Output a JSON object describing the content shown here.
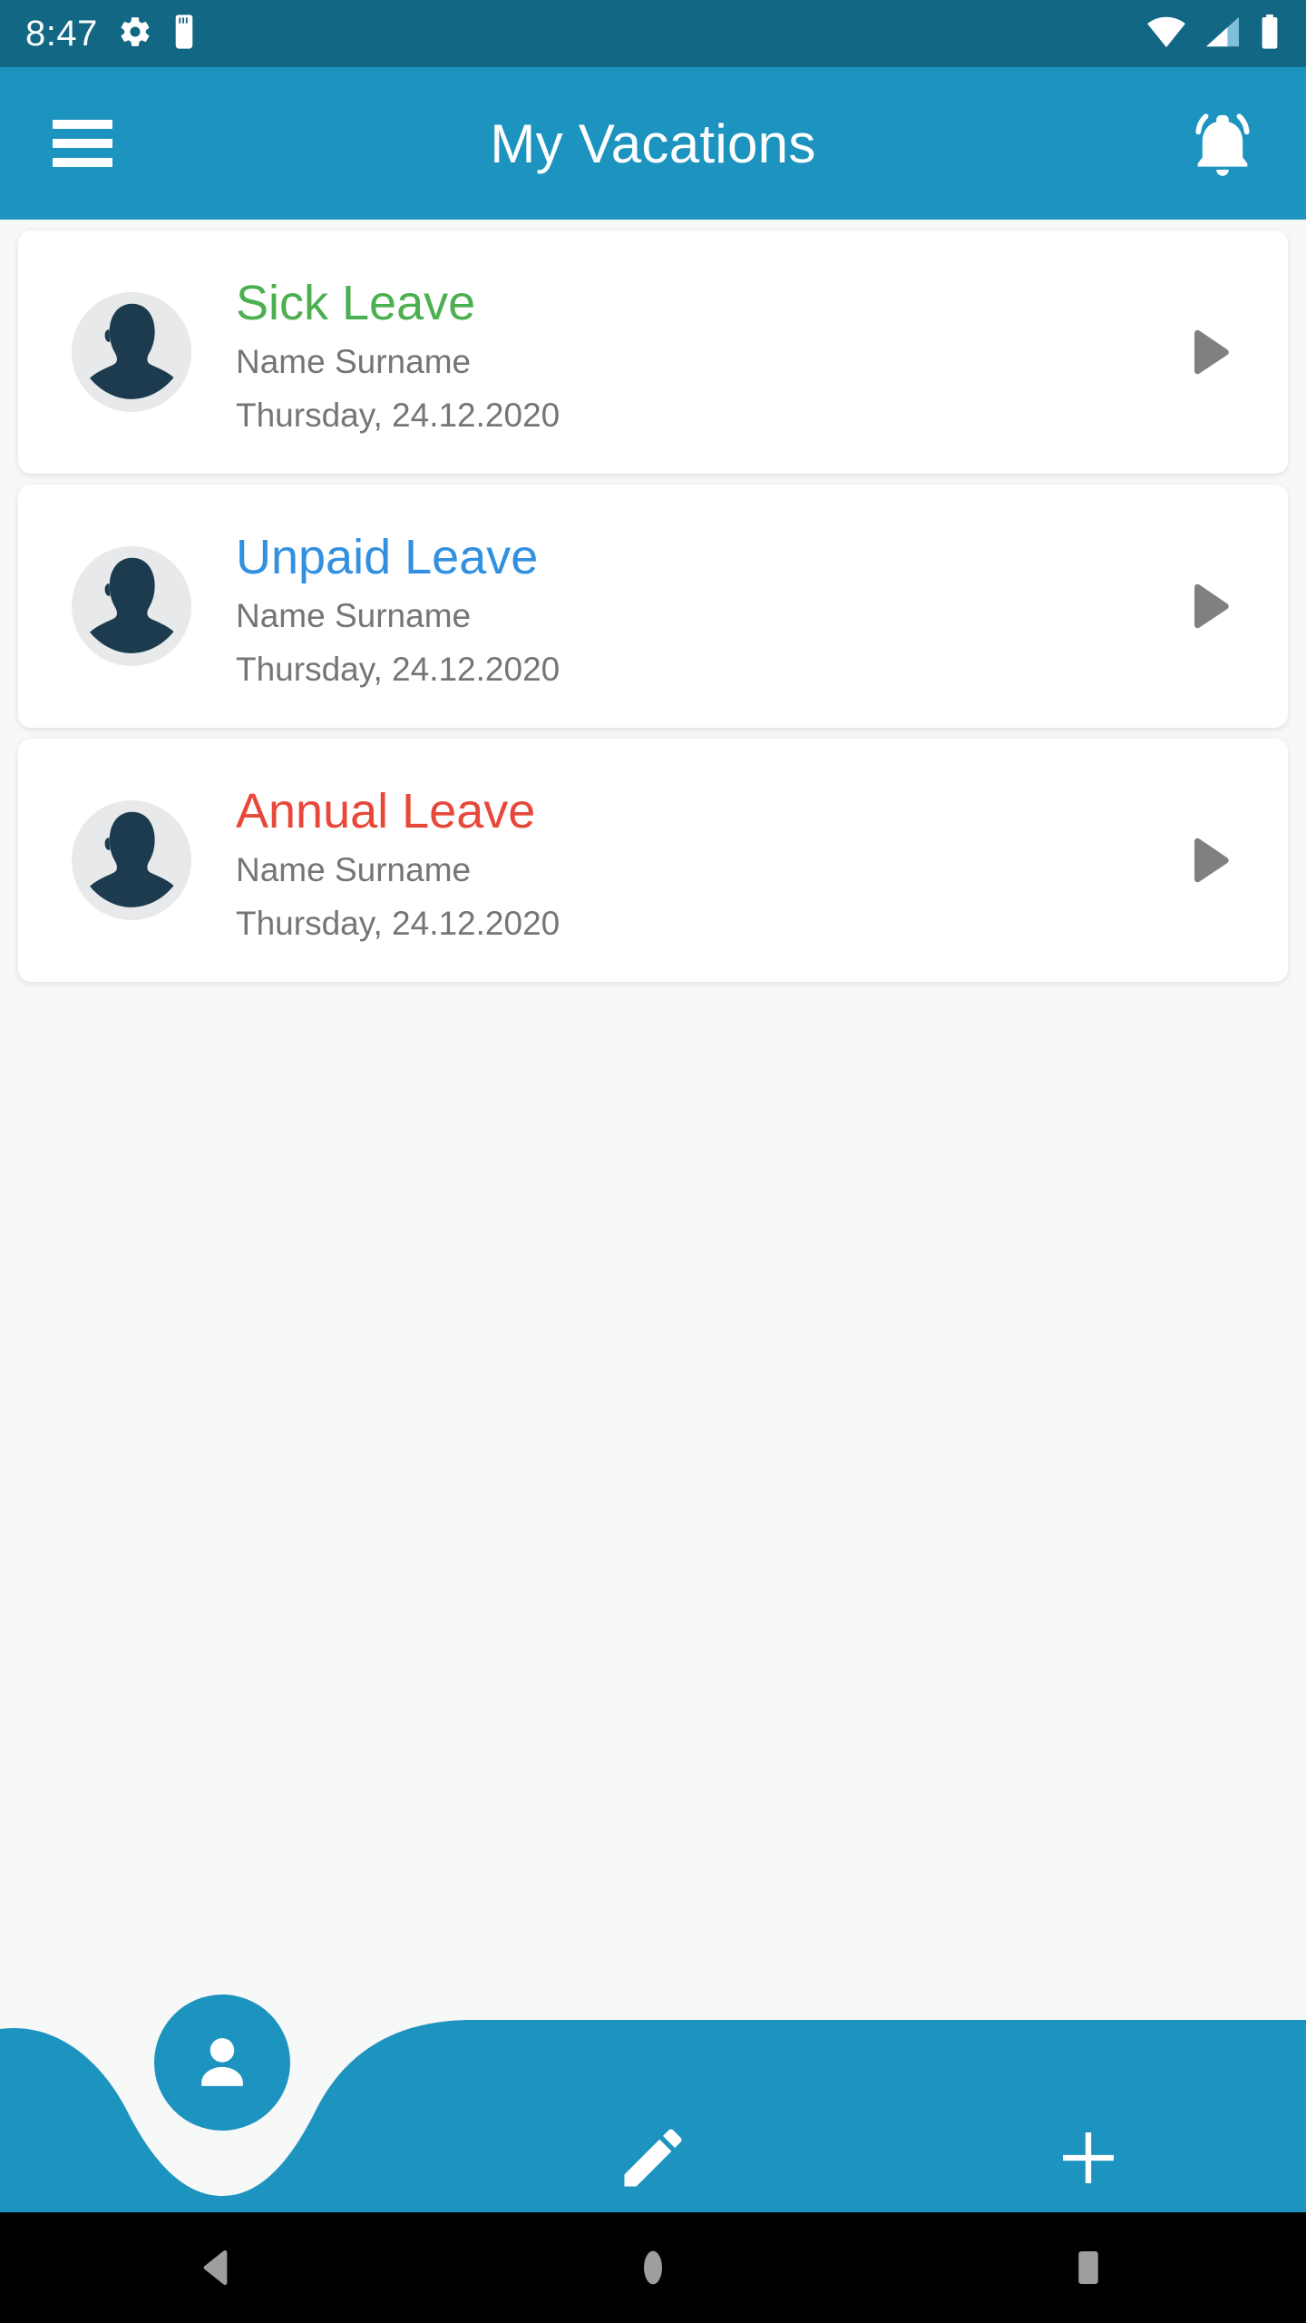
{
  "status_bar": {
    "time": "8:47",
    "background": "#126785",
    "icons": [
      "gear-icon",
      "sd-card-icon",
      "wifi-icon",
      "cell-signal-icon",
      "battery-icon"
    ]
  },
  "app_bar": {
    "title": "My Vacations",
    "background": "#1D94BF",
    "menu_icon": "hamburger-menu-icon",
    "notification_icon": "notifications-active-bell-icon"
  },
  "cards": [
    {
      "title": "Sick Leave",
      "color": "#4CAF50",
      "person": "Name Surname",
      "date": "Thursday, 24.12.2020",
      "avatar": "person-silhouette-avatar",
      "arrow": "chevron-right-icon"
    },
    {
      "title": "Unpaid Leave",
      "color": "#3191E0",
      "person": "Name Surname",
      "date": "Thursday, 24.12.2020",
      "avatar": "person-silhouette-avatar",
      "arrow": "chevron-right-icon"
    },
    {
      "title": "Annual Leave",
      "color": "#E8483A",
      "person": "Name Surname",
      "date": "Thursday, 24.12.2020",
      "avatar": "person-silhouette-avatar",
      "arrow": "chevron-right-icon"
    }
  ],
  "bottom_nav": {
    "background": "#1D94BF",
    "profile_icon": "person-icon",
    "edit_icon": "pencil-edit-icon",
    "add_icon": "plus-icon"
  },
  "android_nav": {
    "back_icon": "back-triangle-icon",
    "home_icon": "home-circle-icon",
    "recents_icon": "recents-square-icon",
    "background": "#000000"
  },
  "theme": {
    "page_background": "#F7F8F8",
    "card_background": "#FFFFFF",
    "muted_text": "#757575",
    "avatar_dark": "#1C3B4F",
    "avatar_light": "#E8E9EA",
    "arrow_gray": "#808080"
  }
}
